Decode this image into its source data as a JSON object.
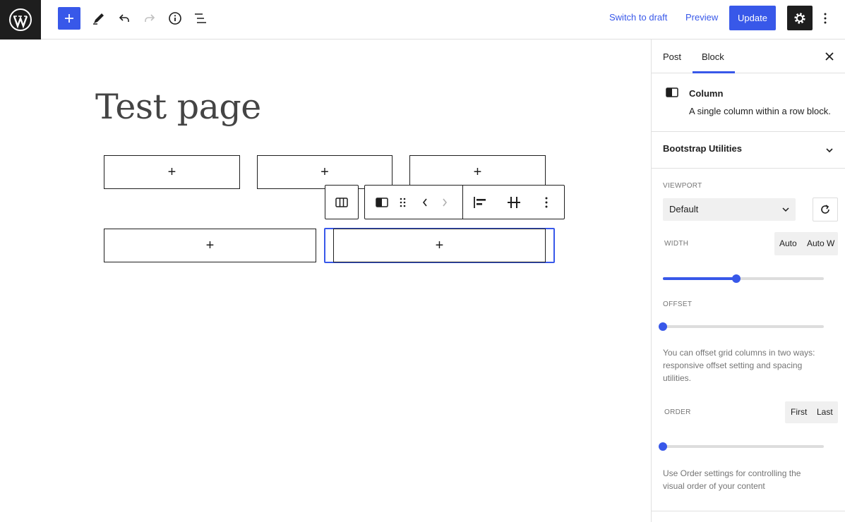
{
  "topbar": {
    "switch_to_draft": "Switch to draft",
    "preview": "Preview",
    "update": "Update"
  },
  "editor": {
    "page_title": "Test page"
  },
  "sidebar": {
    "tabs": [
      "Post",
      "Block"
    ],
    "block": {
      "name": "Column",
      "description": "A single column within a row block."
    },
    "panel_title": "Bootstrap Utilities",
    "viewport": {
      "label": "VIEWPORT",
      "selected": "Default"
    },
    "width": {
      "label": "WIDTH",
      "options": [
        "Auto",
        "Auto W"
      ],
      "slider_fraction": 0.455
    },
    "offset": {
      "label": "OFFSET",
      "slider_fraction": 0.0,
      "help": "You can offset grid columns in two ways: responsive offset setting and spacing utilities."
    },
    "order": {
      "label": "ORDER",
      "options": [
        "First",
        "Last"
      ],
      "slider_fraction": 0.0,
      "help": "Use Order settings for controlling the visual order of your content"
    }
  },
  "colors": {
    "accent": "#3858e9",
    "dark": "#1e1e1e"
  }
}
